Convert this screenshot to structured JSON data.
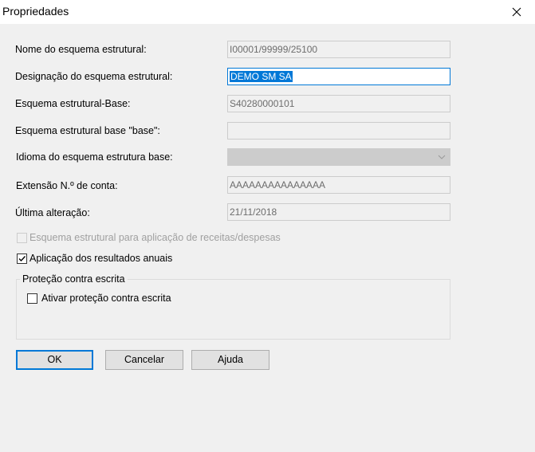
{
  "window": {
    "title": "Propriedades"
  },
  "fields": {
    "nome_label": "Nome do esquema estrutural:",
    "nome_value": "I00001/99999/25100",
    "designacao_label": "Designação do esquema estrutural:",
    "designacao_value": "DEMO SM SA",
    "base_label": "Esquema estrutural-Base:",
    "base_value": "S40280000101",
    "base_base_label": "Esquema estrutural base \"base\":",
    "base_base_value": "",
    "idioma_label": "Idioma do esquema estrutura base:",
    "idioma_value": "",
    "extensao_label": "Extensão N.º de conta:",
    "extensao_value": "AAAAAAAAAAAAAAA",
    "ultima_label": "Última alteração:",
    "ultima_value": "21/11/2018"
  },
  "checkboxes": {
    "receitas_label": "Esquema estrutural para aplicação de receitas/despesas",
    "receitas_checked": false,
    "resultados_label": "Aplicação dos resultados anuais",
    "resultados_checked": true
  },
  "group": {
    "title": "Proteção contra escrita",
    "protecao_label": "Ativar proteção contra escrita",
    "protecao_checked": false
  },
  "buttons": {
    "ok": "OK",
    "cancel": "Cancelar",
    "help": "Ajuda"
  },
  "icons": {
    "close": "close-icon",
    "dropdown": "chevron-down-icon",
    "check": "checkmark-icon"
  },
  "colors": {
    "accent": "#0078d7",
    "background": "#f0f0f0",
    "disabled_text": "#a0a0a0"
  }
}
